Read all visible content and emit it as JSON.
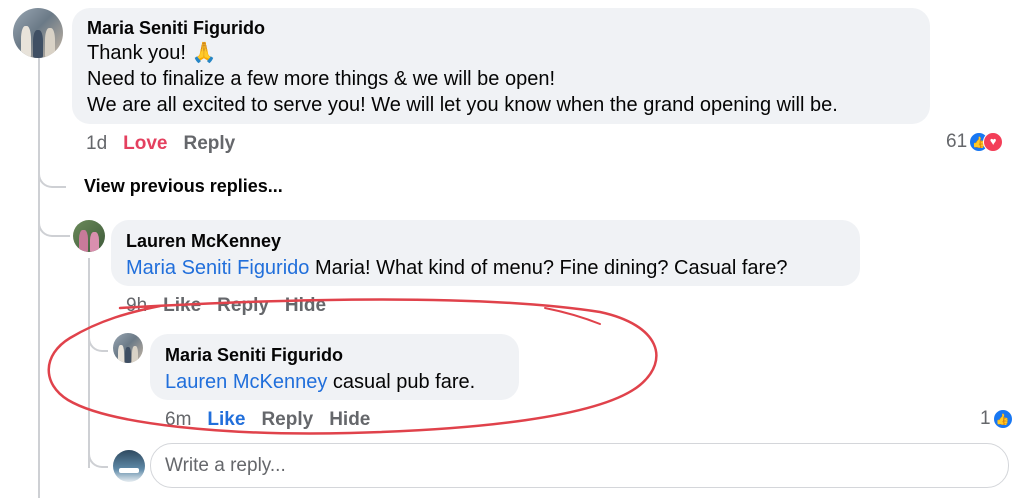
{
  "comment1": {
    "author": "Maria Seniti Figurido",
    "line1": "Thank you! 🙏",
    "line2": "Need to finalize a few more things & we will be open!",
    "line3": "We are all excited to serve you! We will let you know when the grand opening will be.",
    "time": "1d",
    "love_label": "Love",
    "reply_label": "Reply",
    "reaction_count": "61"
  },
  "view_previous": "View previous replies...",
  "comment2": {
    "author": "Lauren McKenney",
    "mention": "Maria Seniti Figurido",
    "text": " Maria! What kind of menu? Fine dining? Casual fare?",
    "time": "9h",
    "like_label": "Like",
    "reply_label": "Reply",
    "hide_label": "Hide"
  },
  "comment3": {
    "author": "Maria Seniti Figurido",
    "mention": "Lauren McKenney",
    "text": " casual pub fare.",
    "time": "6m",
    "like_label": "Like",
    "reply_label": "Reply",
    "hide_label": "Hide",
    "reaction_count": "1"
  },
  "reply_box": {
    "placeholder": "Write a reply..."
  },
  "colors": {
    "bubble": "#f0f2f5",
    "mention": "#216fdb",
    "love": "#e4405f",
    "like_active": "#216fdb",
    "meta": "#65676b",
    "annotation_red": "#e0424b"
  }
}
